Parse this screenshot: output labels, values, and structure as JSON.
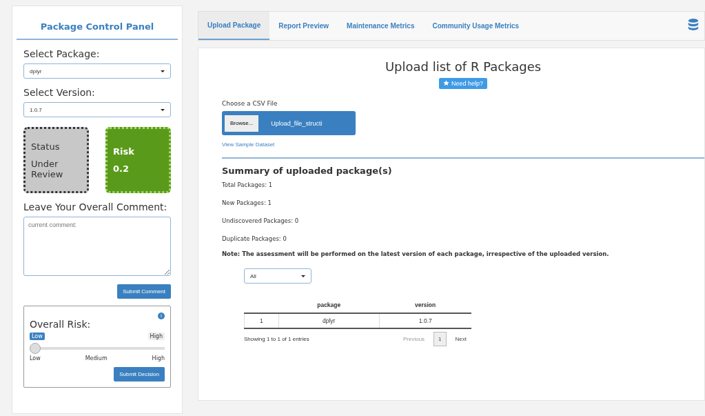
{
  "sidebar": {
    "title": "Package Control Panel",
    "package_select": {
      "label": "Select Package:",
      "value": "dplyr"
    },
    "version_select": {
      "label": "Select Version:",
      "value": "1.0.7"
    },
    "status_box": {
      "label": "Status",
      "value": "Under Review"
    },
    "risk_box": {
      "label": "Risk",
      "value": "0.2"
    },
    "comment": {
      "label": "Leave Your Overall Comment:",
      "placeholder": "current comment:"
    },
    "submit_comment": "Submit Comment",
    "overall_risk": {
      "label": "Overall Risk:",
      "info": "i",
      "min_label": "Low",
      "max_label": "High",
      "level": 0,
      "ticks": [
        "Low",
        "Medium",
        "High"
      ],
      "submit": "Submit Decision"
    }
  },
  "tabs": [
    {
      "label": "Upload Package",
      "selected": true
    },
    {
      "label": "Report Preview",
      "selected": false
    },
    {
      "label": "Maintenance Metrics",
      "selected": false
    },
    {
      "label": "Community Usage Metrics",
      "selected": false
    }
  ],
  "upload": {
    "title": "Upload list of R Packages",
    "help": "Need help?",
    "file_label": "Choose a CSV File",
    "browse": "Browse...",
    "file_name": "Upload_file_structi",
    "sample_link": "View Sample Dataset"
  },
  "summary": {
    "title": "Summary of uploaded package(s)",
    "lines": [
      "Total Packages: 1",
      "New Packages: 1",
      "Undiscovered Packages: 0",
      "Duplicate Packages: 0"
    ],
    "note": "Note: The assessment will be performed on the latest version of each package, irrespective of the uploaded version."
  },
  "table": {
    "filter": "All",
    "columns": [
      "",
      "package",
      "version"
    ],
    "rows": [
      [
        "1",
        "dplyr",
        "1.0.7"
      ]
    ],
    "info": "Showing 1 to 1 of 1 entries",
    "pages": [
      {
        "label": "Previous",
        "selected": false,
        "disabled": true
      },
      {
        "label": "1",
        "selected": true,
        "disabled": false
      },
      {
        "label": "Next",
        "selected": false,
        "disabled": false
      }
    ]
  }
}
